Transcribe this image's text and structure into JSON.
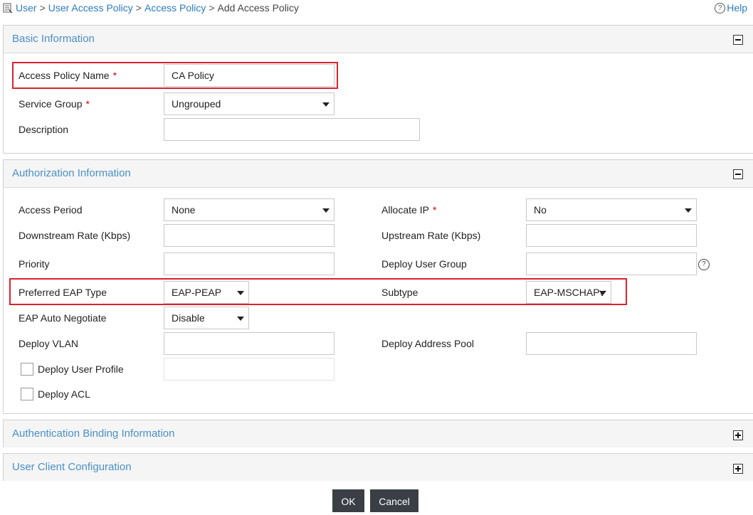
{
  "breadcrumb": {
    "items": [
      "User",
      "User Access Policy",
      "Access Policy",
      "Add Access Policy"
    ],
    "separator": ">"
  },
  "help": {
    "icon": "?",
    "label": "Help"
  },
  "basic": {
    "title": "Basic Information",
    "toggle_icon": "minus-icon",
    "policy_name_label": "Access Policy Name",
    "policy_name_value": "CA Policy",
    "service_group_label": "Service Group",
    "service_group_value": "Ungrouped",
    "description_label": "Description",
    "description_value": "",
    "required_mark": "*"
  },
  "auth": {
    "title": "Authorization Information",
    "toggle_icon": "minus-icon",
    "access_period_label": "Access Period",
    "access_period_value": "None",
    "allocate_ip_label": "Allocate IP",
    "allocate_ip_value": "No",
    "downstream_label": "Downstream Rate (Kbps)",
    "downstream_value": "",
    "upstream_label": "Upstream Rate (Kbps)",
    "upstream_value": "",
    "priority_label": "Priority",
    "priority_value": "",
    "deploy_user_group_label": "Deploy User Group",
    "deploy_user_group_value": "",
    "deploy_user_group_help": "?",
    "eap_type_label": "Preferred EAP Type",
    "eap_type_value": "EAP-PEAP",
    "subtype_label": "Subtype",
    "subtype_value": "EAP-MSCHAPv",
    "eap_auto_label": "EAP Auto Negotiate",
    "eap_auto_value": "Disable",
    "deploy_vlan_label": "Deploy VLAN",
    "deploy_vlan_value": "",
    "deploy_address_pool_label": "Deploy Address Pool",
    "deploy_address_pool_value": "",
    "deploy_user_profile_label": "Deploy User Profile",
    "deploy_user_profile_checked": false,
    "deploy_acl_label": "Deploy ACL",
    "deploy_acl_checked": false
  },
  "binding": {
    "title": "Authentication Binding Information",
    "toggle_icon": "plus-icon"
  },
  "client": {
    "title": "User Client Configuration",
    "toggle_icon": "plus-icon"
  },
  "actions": {
    "ok_label": "OK",
    "cancel_label": "Cancel"
  },
  "colors": {
    "link": "#2b7bc0",
    "section_title": "#4a90c8",
    "highlight": "#d9232d",
    "button_bg": "#3a3f45",
    "required": "#d0021b"
  }
}
